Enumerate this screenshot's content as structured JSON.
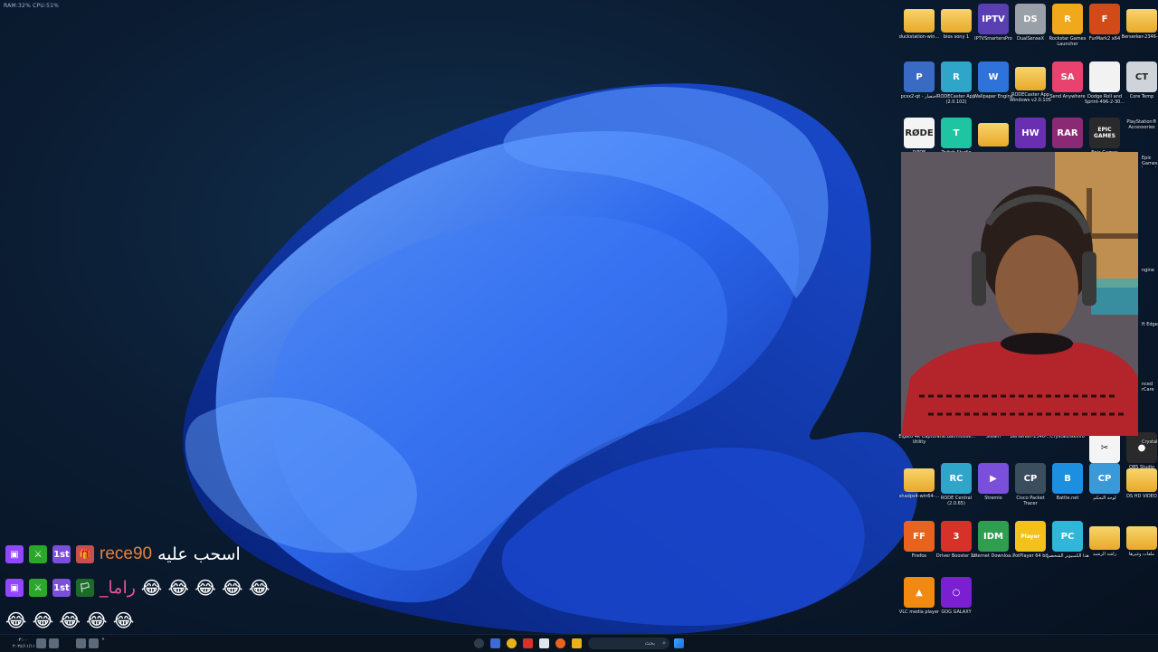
{
  "perf_overlay": "RAM:32%  CPU:51%",
  "desktop_icons": [
    {
      "label": "duckstation-win...",
      "kind": "folder"
    },
    {
      "label": "bios sony 1",
      "kind": "folder"
    },
    {
      "label": "IPTVSmartersPro",
      "kind": "app",
      "text": "IPTV",
      "color": "#5a3fb0"
    },
    {
      "label": "DualSenseX",
      "kind": "app",
      "text": "DS",
      "color": "#9aa0a8"
    },
    {
      "label": "Rockstar Games Launcher",
      "kind": "app",
      "text": "R",
      "color": "#f2a81d"
    },
    {
      "label": "FurMark2 x64",
      "kind": "app",
      "text": "F",
      "color": "#d24a18"
    },
    {
      "label": "Berserker-2346-...",
      "kind": "folder"
    },
    {
      "label": "pcsx2-qt - اختصار",
      "kind": "app",
      "text": "P",
      "color": "#3a6bc4"
    },
    {
      "label": "RODECaster App (2.0.102)",
      "kind": "app",
      "text": "R",
      "color": "#2fa6c9"
    },
    {
      "label": "Wallpaper Engine",
      "kind": "app",
      "text": "W",
      "color": "#2e73d9"
    },
    {
      "label": "RODECaster App Windows v2.0.105",
      "kind": "folder"
    },
    {
      "label": "Send Anywhere",
      "kind": "app",
      "text": "SA",
      "color": "#e8436e"
    },
    {
      "label": "Dodge Roll and Sprint-496-2-30...",
      "kind": "app",
      "text": "",
      "color": "#f2f2f2"
    },
    {
      "label": "Core Temp",
      "kind": "app",
      "text": "CT",
      "color": "#cfd4da"
    },
    {
      "label": "RØDE",
      "kind": "app",
      "text": "RØDE",
      "color": "#f4f4f4"
    },
    {
      "label": "Twitch Studio",
      "kind": "app",
      "text": "T",
      "color": "#1fc4a3"
    },
    {
      "label": "",
      "kind": "folder"
    },
    {
      "label": "",
      "kind": "app",
      "text": "HW",
      "color": "#6a2fb0"
    },
    {
      "label": "",
      "kind": "app",
      "text": "RAR",
      "color": "#8a2a74"
    },
    {
      "label": "Epic Games Launcher",
      "kind": "app",
      "text": "EPIC GAMES",
      "color": "#2a2a2a"
    },
    {
      "label": "PlayStation® Accessories",
      "kind": "hidden"
    },
    {
      "label": "Elgato 4K Capture Utility",
      "kind": "hidden"
    },
    {
      "label": "The.Bathhouse...",
      "kind": "hidden"
    },
    {
      "label": "Steam",
      "kind": "hidden"
    },
    {
      "label": "Berserker-2346-...",
      "kind": "hidden"
    },
    {
      "label": "CrystalDiskInfo",
      "kind": "hidden"
    },
    {
      "label": "CapCut",
      "kind": "app",
      "text": "✂",
      "color": "#f4f4f4"
    },
    {
      "label": "OBS Studio",
      "kind": "app",
      "text": "●",
      "color": "#2a2a2a"
    },
    {
      "label": "shadps4-win64-...",
      "kind": "folder"
    },
    {
      "label": "RODE Central (2.0.65)",
      "kind": "app",
      "text": "RC",
      "color": "#2fa6c9"
    },
    {
      "label": "Stremio",
      "kind": "app",
      "text": "▶",
      "color": "#7a4fd9"
    },
    {
      "label": "Cisco Packet Tracer",
      "kind": "app",
      "text": "CP",
      "color": "#3b4e5e"
    },
    {
      "label": "Battle.net",
      "kind": "app",
      "text": "B",
      "color": "#1d8fe0"
    },
    {
      "label": "لوحة التحكم",
      "kind": "app",
      "text": "CP",
      "color": "#3a9ad9"
    },
    {
      "label": "DS HD VIDEO",
      "kind": "folder"
    },
    {
      "label": "Firefox",
      "kind": "app",
      "text": "FF",
      "color": "#e8641e"
    },
    {
      "label": "Driver Booster 12",
      "kind": "app",
      "text": "3",
      "color": "#d8312a"
    },
    {
      "label": "Internet Downloa...",
      "kind": "app",
      "text": "IDM",
      "color": "#2f9e4f"
    },
    {
      "label": "PotPlayer 64 bit",
      "kind": "app",
      "text": "Player",
      "color": "#f2c21a"
    },
    {
      "label": "هذا الكمبيوتر الشخصي",
      "kind": "app",
      "text": "PC",
      "color": "#2fb6d9"
    },
    {
      "label": "راشد الرشيد",
      "kind": "folder"
    },
    {
      "label": "ملفات وغيرها",
      "kind": "folder"
    },
    {
      "label": "VLC media player",
      "kind": "app",
      "text": "▲",
      "color": "#f28a12"
    },
    {
      "label": "GOG GALAXY",
      "kind": "app",
      "text": "○",
      "color": "#7a1fd1"
    }
  ],
  "side_labels": [
    "Epic Games Launcher",
    "ngine",
    "ft Edge",
    "nced rCare",
    "CrystalDiskInfo"
  ],
  "chat": [
    {
      "user": "rece90",
      "message": "اسحب عليه",
      "user_color": "#e8803a",
      "badges": [
        "twitch",
        "sword",
        "1st",
        "gift"
      ]
    },
    {
      "user": "_راما",
      "message": "😂 😂 😂 😂 😂",
      "user_color": "#e8539a",
      "badges": [
        "twitch",
        "sword",
        "1st",
        "flag"
      ]
    },
    {
      "user": "",
      "message": "😂 😂 😂 😂 😂",
      "user_color": "#ffffff",
      "badges": []
    }
  ],
  "taskbar": {
    "search_placeholder": "بحث",
    "tray_time": "٠٣:٠٠",
    "tray_date": "٢٠٢٤/١١/١١"
  }
}
